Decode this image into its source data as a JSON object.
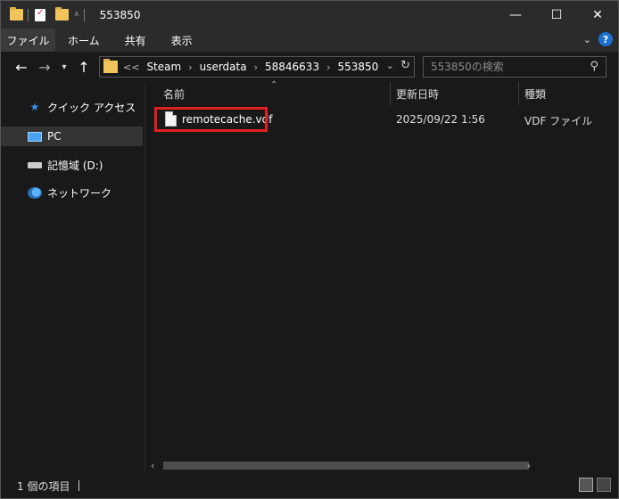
{
  "window": {
    "title": "553850",
    "controls": {
      "minimize": "—",
      "maximize": "☐",
      "close": "✕"
    }
  },
  "ribbon": {
    "tabs": [
      {
        "label": "ファイル"
      },
      {
        "label": "ホーム"
      },
      {
        "label": "共有"
      },
      {
        "label": "表示"
      }
    ],
    "help": "?"
  },
  "address_bar": {
    "overflow": "<<",
    "crumbs": [
      "Steam",
      "userdata",
      "58846633",
      "553850"
    ]
  },
  "search": {
    "placeholder": "553850の検索"
  },
  "sidebar": {
    "items": [
      {
        "label": "クイック アクセス",
        "icon": "star-icon"
      },
      {
        "label": "PC",
        "icon": "pc-icon",
        "selected": true
      },
      {
        "label": "記憶域 (D:)",
        "icon": "drive-icon"
      },
      {
        "label": "ネットワーク",
        "icon": "network-icon"
      }
    ]
  },
  "columns": {
    "name": "名前",
    "date": "更新日時",
    "type": "種類"
  },
  "files": [
    {
      "name": "remotecache.vdf",
      "date": "2025/09/22 1:56",
      "type": "VDF ファイル"
    }
  ],
  "status": {
    "count": "1 個の項目"
  },
  "colors": {
    "accent": "#1d6fd1",
    "highlight_border": "#e02020",
    "folder": "#f2c55c"
  }
}
